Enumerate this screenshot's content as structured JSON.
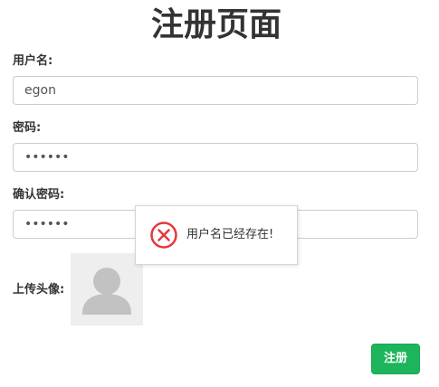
{
  "page": {
    "title": "注册页面"
  },
  "form": {
    "username": {
      "label": "用户名:",
      "value": "egon"
    },
    "password": {
      "label": "密码:",
      "value": "••••••"
    },
    "confirm_password": {
      "label": "确认密码:",
      "value": "••••••"
    },
    "avatar": {
      "label": "上传头像:",
      "icon": "default-avatar-icon"
    },
    "submit_label": "注册"
  },
  "toast": {
    "message": "用户名已经存在!",
    "icon": "error-circle-x-icon",
    "icon_color": "#e5383b"
  },
  "colors": {
    "submit_button": "#1db55b",
    "input_border": "#cccccc",
    "avatar_background": "#eeeeee"
  }
}
